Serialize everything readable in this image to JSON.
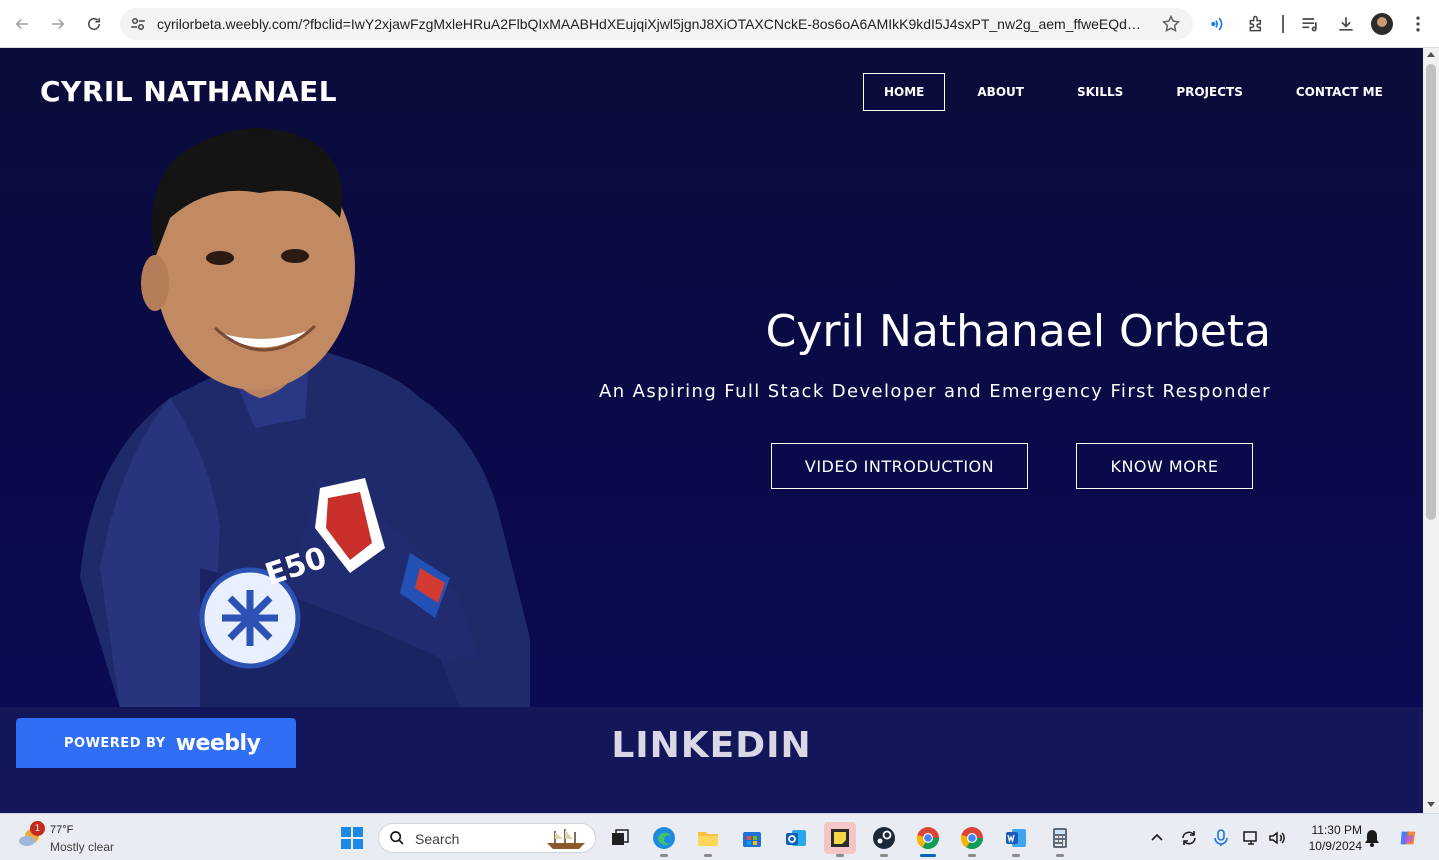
{
  "browser": {
    "url": "cyrilorbeta.weebly.com/?fbclid=IwY2xjawFzgMxleHRuA2FlbQIxMAABHdXEujqiXjwl5jgnJ8XiOTAXCNckE-8os6oA6AMIkK9kdI5J4sxPT_nw2g_aem_ffweEQdTEjMT..."
  },
  "site": {
    "logo": "CYRIL NATHANAEL",
    "nav": [
      {
        "label": "HOME"
      },
      {
        "label": "ABOUT"
      },
      {
        "label": "SKILLS"
      },
      {
        "label": "PROJECTS"
      },
      {
        "label": "CONTACT ME"
      }
    ],
    "hero": {
      "title": "Cyril Nathanael Orbeta",
      "subtitle": "An Aspiring Full Stack Developer and Emergency First Responder",
      "button_video": "VIDEO INTRODUCTION",
      "button_know": "KNOW MORE"
    },
    "section2_title": "LINKEDIN",
    "badge": {
      "powered_by": "POWERED BY",
      "brand": "weebly"
    },
    "colors": {
      "hero_bg": "#0a0a4c",
      "section2_bg": "#13175a",
      "badge_bg": "#2f6ef5"
    }
  },
  "taskbar": {
    "weather": {
      "badge": "1",
      "temp": "77°F",
      "condition": "Mostly clear"
    },
    "search_placeholder": "Search",
    "clock": {
      "time": "11:30 PM",
      "date": "10/9/2024"
    }
  }
}
